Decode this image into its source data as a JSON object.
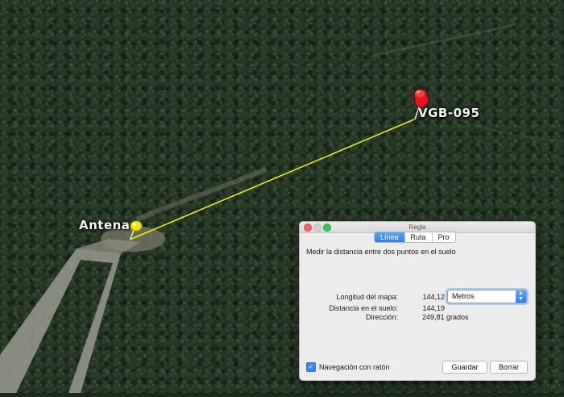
{
  "map": {
    "placemarks": [
      {
        "label": "Antena",
        "color": "#f2e600"
      },
      {
        "label": "VGB-095",
        "color": "#e8141b"
      }
    ],
    "line_color": "#f5f500"
  },
  "dialog": {
    "title": "Regla",
    "tabs": [
      {
        "label": "Línea",
        "active": true
      },
      {
        "label": "Ruta",
        "active": false
      },
      {
        "label": "Pro",
        "active": false
      }
    ],
    "description": "Medir la distancia entre dos puntos en el suelo",
    "map_length_label": "Longitud del mapa:",
    "map_length_value": "144,12",
    "unit_selected": "Metros",
    "ground_distance_label": "Distancia en el suelo:",
    "ground_distance_value": "144,19",
    "direction_label": "Dirección:",
    "direction_value": "249,81 grados",
    "mouse_nav_label": "Navegación con ratón",
    "mouse_nav_checked": true,
    "save_label": "Guardar",
    "clear_label": "Borrar"
  }
}
